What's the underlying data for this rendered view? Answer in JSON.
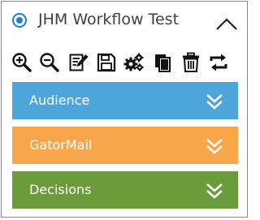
{
  "header": {
    "title": "JHM Workflow Test"
  },
  "toolbar": {
    "icons": [
      "zoom-in-icon",
      "zoom-out-icon",
      "edit-icon",
      "save-icon",
      "settings-icon",
      "copy-icon",
      "trash-icon",
      "refresh-icon"
    ]
  },
  "sections": [
    {
      "label": "Audience",
      "color": "#4ea5d9"
    },
    {
      "label": "GatorMail",
      "color": "#f9a64a"
    },
    {
      "label": "Decisions",
      "color": "#6a9c3c"
    }
  ],
  "colors": {
    "accent": "#1e7fd6",
    "text": "#404040"
  }
}
